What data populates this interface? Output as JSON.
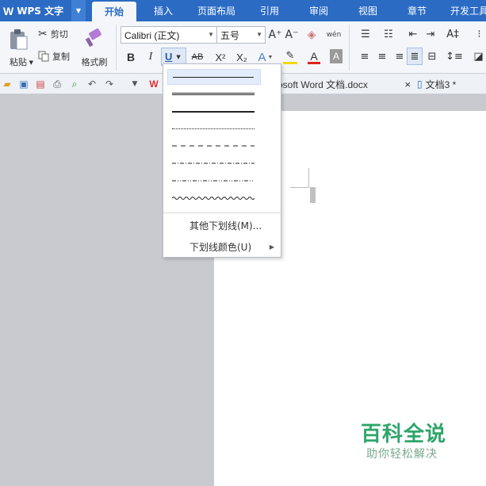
{
  "app": {
    "logo": "W",
    "name": "WPS 文字"
  },
  "tabs": [
    {
      "label": "开始",
      "active": true
    },
    {
      "label": "插入"
    },
    {
      "label": "页面布局"
    },
    {
      "label": "引用"
    },
    {
      "label": "审阅"
    },
    {
      "label": "视图"
    },
    {
      "label": "章节"
    },
    {
      "label": "开发工具"
    }
  ],
  "ribbon": {
    "paste_label": "粘贴",
    "cut_label": "剪切",
    "copy_label": "复制",
    "format_painter_label": "格式刷",
    "font_name": "Calibri (正文)",
    "font_size": "五号",
    "bold": "B",
    "italic": "I",
    "underline": "U",
    "strikethrough": "AB",
    "superscript": "X²",
    "subscript": "X₂",
    "text_effect": "A",
    "font_color": "A",
    "char_shading": "A",
    "grow_font": "A⁺",
    "shrink_font": "A⁻",
    "phonetic": "wén"
  },
  "documents": {
    "tab1_label": "rosoft Word 文档.docx",
    "tab2_label": "文档3 *",
    "close": "×"
  },
  "underline_menu": {
    "styles": [
      "single",
      "double",
      "thick",
      "dotted",
      "dashed",
      "dash-dot",
      "dash-dot-dot",
      "wavy"
    ],
    "more_label": "其他下划线(M)...",
    "color_label": "下划线颜色(U)"
  },
  "watermark": {
    "title": "百科全说",
    "subtitle": "助你轻松解决"
  },
  "colors": {
    "accent": "#2b6bc4",
    "watermark": "#2fa56a",
    "font_color_bar": "#e02020",
    "highlight_bar": "#f5d800"
  }
}
